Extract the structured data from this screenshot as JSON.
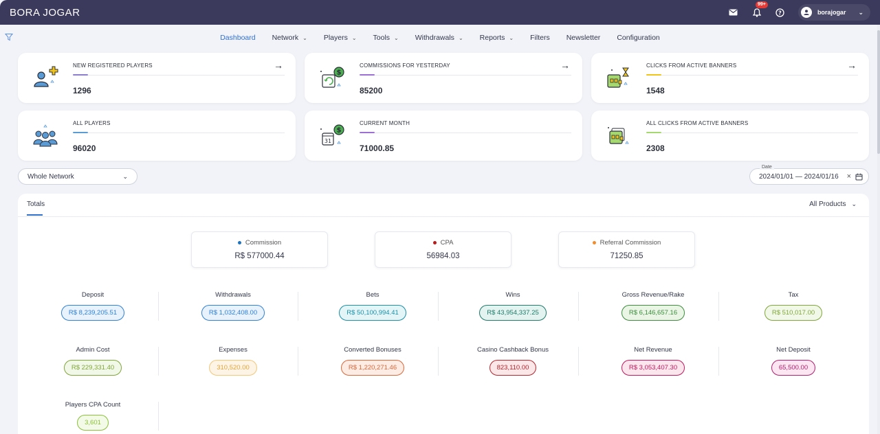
{
  "app": {
    "brand": "BORA JOGAR",
    "notifications_badge": "99+",
    "username": "borajogar"
  },
  "nav": {
    "items": [
      {
        "label": "Dashboard",
        "dropdown": false
      },
      {
        "label": "Network",
        "dropdown": true
      },
      {
        "label": "Players",
        "dropdown": true
      },
      {
        "label": "Tools",
        "dropdown": true
      },
      {
        "label": "Withdrawals",
        "dropdown": true
      },
      {
        "label": "Reports",
        "dropdown": true
      },
      {
        "label": "Filters",
        "dropdown": false
      },
      {
        "label": "Newsletter",
        "dropdown": false
      },
      {
        "label": "Configuration",
        "dropdown": false
      }
    ]
  },
  "stats": [
    {
      "label": "NEW REGISTERED PLAYERS",
      "value": "1296",
      "accent": "#8a7ccf",
      "arrow": true
    },
    {
      "label": "COMMISSIONS FOR YESTERDAY",
      "value": "85200",
      "accent": "#9b6fd6",
      "arrow": true
    },
    {
      "label": "CLICKS FROM ACTIVE BANNERS",
      "value": "1548",
      "accent": "#f0c419",
      "arrow": true
    },
    {
      "label": "ALL PLAYERS",
      "value": "96020",
      "accent": "#5b9bd5",
      "arrow": false
    },
    {
      "label": "CURRENT MONTH",
      "value": "71000.85",
      "accent": "#9b6fd6",
      "arrow": false
    },
    {
      "label": "ALL CLICKS FROM ACTIVE BANNERS",
      "value": "2308",
      "accent": "#a5d86e",
      "arrow": false
    }
  ],
  "filters": {
    "network": "Whole Network",
    "date_legend": "Date",
    "date_range": "2024/01/01 — 2024/01/16"
  },
  "totals": {
    "tab": "Totals",
    "products": "All Products",
    "summary": [
      {
        "label": "Commission",
        "value": "R$ 577000.44",
        "dot": "#1e73be"
      },
      {
        "label": "CPA",
        "value": "56984.03",
        "dot": "#b71c1c"
      },
      {
        "label": "Referral Commission",
        "value": "71250.85",
        "dot": "#f08c2e"
      }
    ],
    "metrics": [
      {
        "title": "Deposit",
        "value": "R$ 8,239,205.51",
        "color": "#2f80d6",
        "bg": "#e8f2fc"
      },
      {
        "title": "Withdrawals",
        "value": "R$ 1,032,408.00",
        "color": "#2f80d6",
        "bg": "#e8f2fc"
      },
      {
        "title": "Bets",
        "value": "R$ 50,100,994.41",
        "color": "#1a8fa6",
        "bg": "#e4f5f8"
      },
      {
        "title": "Wins",
        "value": "R$ 43,954,337.25",
        "color": "#1e7a6a",
        "bg": "#e3f3ef"
      },
      {
        "title": "Gross Revenue/Rake",
        "value": "R$ 6,146,657.16",
        "color": "#3c8c3c",
        "bg": "#eaf5e6"
      },
      {
        "title": "Tax",
        "value": "R$ 510,017.00",
        "color": "#7fa63a",
        "bg": "#f2f8e8"
      },
      {
        "title": "Admin Cost",
        "value": "R$ 229,331.40",
        "color": "#7fa63a",
        "bg": "#f2f8e8"
      },
      {
        "title": "Expenses",
        "value": "310,520.00",
        "color": "#e3a53c",
        "bg": "#fdf4e6"
      },
      {
        "title": "Converted Bonuses",
        "value": "R$ 1,220,271.46",
        "color": "#d9683c",
        "bg": "#fcece4"
      },
      {
        "title": "Casino Cashback Bonus",
        "value": "823,110.00",
        "color": "#b3262e",
        "bg": "#fbe7e8"
      },
      {
        "title": "Net Revenue",
        "value": "R$ 3,053,407.30",
        "color": "#c2185b",
        "bg": "#fbe6ee"
      },
      {
        "title": "Net Deposit",
        "value": "65,500.00",
        "color": "#b0206e",
        "bg": "#fbe6f1"
      },
      {
        "title": "Players CPA Count",
        "value": "3,601",
        "color": "#8bbf3a",
        "bg": "#f3fae8"
      }
    ]
  }
}
